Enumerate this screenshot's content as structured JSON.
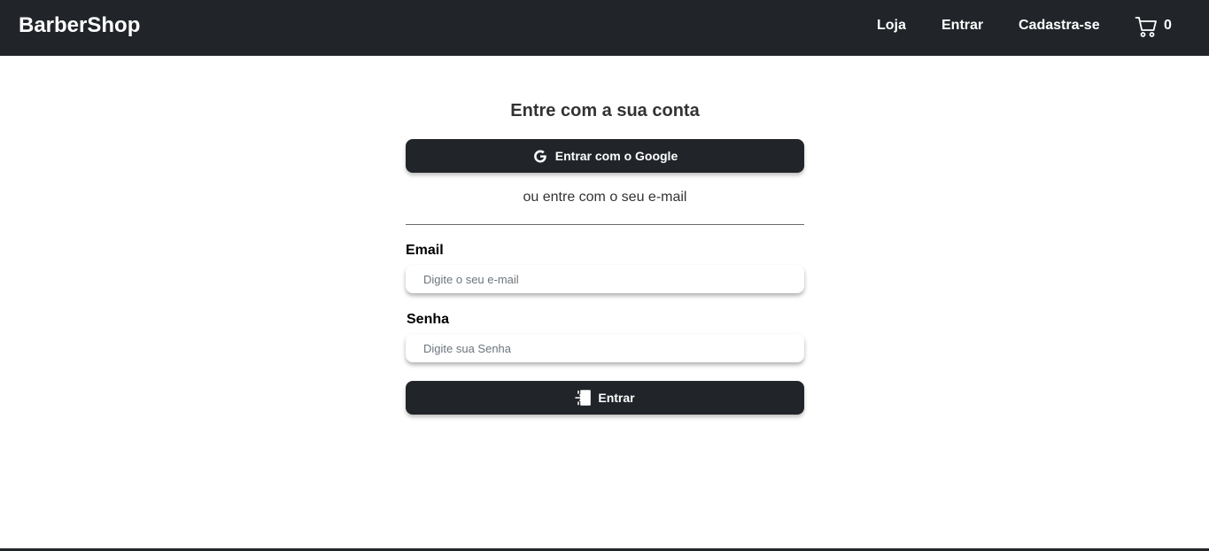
{
  "navbar": {
    "brand": "BarberShop",
    "links": [
      "Loja",
      "Entrar",
      "Cadastra-se"
    ],
    "cart_icon": "cart-icon",
    "cart_count": "0",
    "background": "#212529"
  },
  "login": {
    "title": "Entre com a sua conta",
    "google_button_label": "Entrar com o Google",
    "google_icon": "google-icon",
    "or_text": "ou entre com o seu e-mail",
    "email_label": "Email",
    "email_placeholder": "Digite o seu e-mail",
    "email_value": "",
    "password_label": "Senha",
    "password_placeholder": "Digite sua Senha",
    "password_value": "",
    "submit_label": "Entrar",
    "submit_icon": "sign-in-icon"
  }
}
